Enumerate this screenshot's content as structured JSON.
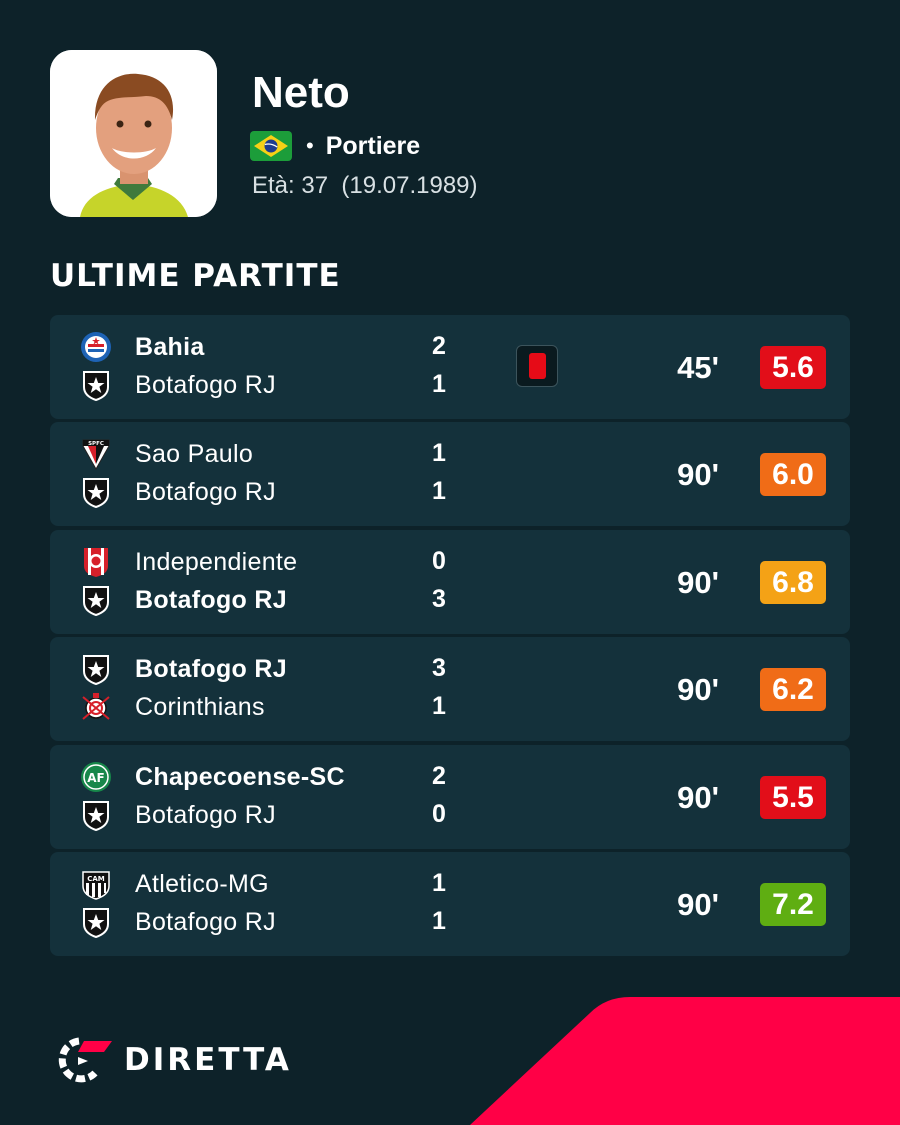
{
  "player": {
    "name": "Neto",
    "position": "Portiere",
    "age": "Età: 37",
    "birthdate": "(19.07.1989)",
    "nationality_flag": "brazil-flag"
  },
  "section_title": "ULTIME PARTITE",
  "matches": [
    {
      "home": {
        "name": "Bahia",
        "crest": "bahia-crest-icon",
        "bold": true
      },
      "away": {
        "name": "Botafogo RJ",
        "crest": "botafogo-crest-icon",
        "bold": false
      },
      "home_score": "2",
      "away_score": "1",
      "red_card": true,
      "minutes": "45'",
      "rating": "5.6",
      "rating_color": "#e20e19"
    },
    {
      "home": {
        "name": "Sao Paulo",
        "crest": "sao-paulo-crest-icon",
        "bold": false
      },
      "away": {
        "name": "Botafogo RJ",
        "crest": "botafogo-crest-icon",
        "bold": false
      },
      "home_score": "1",
      "away_score": "1",
      "red_card": false,
      "minutes": "90'",
      "rating": "6.0",
      "rating_color": "#f06c17"
    },
    {
      "home": {
        "name": "Independiente",
        "crest": "independiente-crest-icon",
        "bold": false
      },
      "away": {
        "name": "Botafogo RJ",
        "crest": "botafogo-crest-icon",
        "bold": true
      },
      "home_score": "0",
      "away_score": "3",
      "red_card": false,
      "minutes": "90'",
      "rating": "6.8",
      "rating_color": "#f4a216"
    },
    {
      "home": {
        "name": "Botafogo RJ",
        "crest": "botafogo-crest-icon",
        "bold": true
      },
      "away": {
        "name": "Corinthians",
        "crest": "corinthians-crest-icon",
        "bold": false
      },
      "home_score": "3",
      "away_score": "1",
      "red_card": false,
      "minutes": "90'",
      "rating": "6.2",
      "rating_color": "#f06c17"
    },
    {
      "home": {
        "name": "Chapecoense-SC",
        "crest": "chapecoense-crest-icon",
        "bold": true
      },
      "away": {
        "name": "Botafogo RJ",
        "crest": "botafogo-crest-icon",
        "bold": false
      },
      "home_score": "2",
      "away_score": "0",
      "red_card": false,
      "minutes": "90'",
      "rating": "5.5",
      "rating_color": "#e20e19"
    },
    {
      "home": {
        "name": "Atletico-MG",
        "crest": "atletico-mg-crest-icon",
        "bold": false
      },
      "away": {
        "name": "Botafogo RJ",
        "crest": "botafogo-crest-icon",
        "bold": false
      },
      "home_score": "1",
      "away_score": "1",
      "red_card": false,
      "minutes": "90'",
      "rating": "7.2",
      "rating_color": "#5fae12"
    }
  ],
  "brand": {
    "name": "DIRETTA",
    "accent_color": "#ff0046"
  }
}
